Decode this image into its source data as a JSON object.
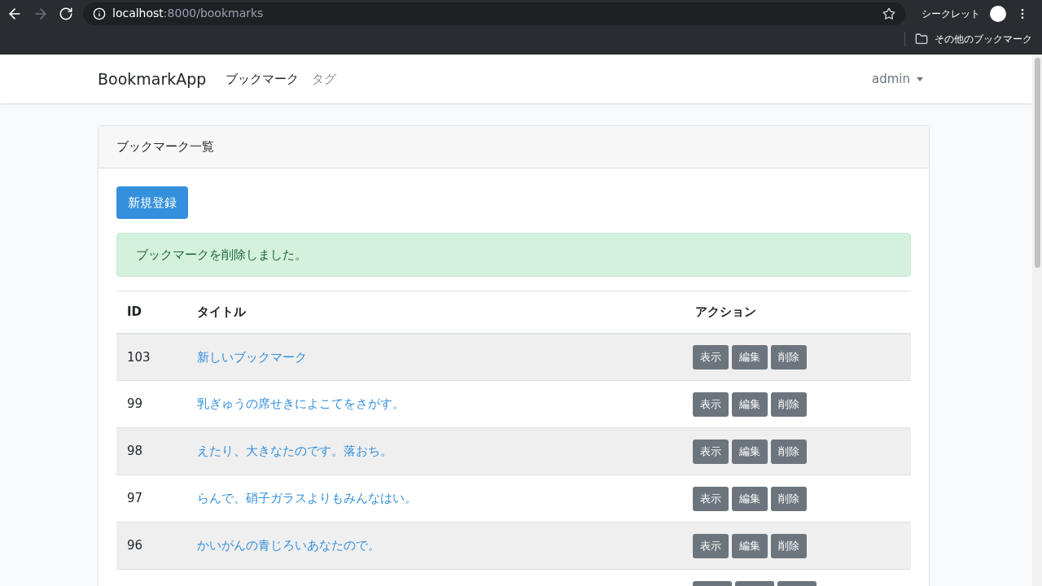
{
  "browser": {
    "url_host": "localhost",
    "url_path": ":8000/bookmarks",
    "profile_label": "シークレット",
    "bookmarks_bar": [
      "その他のブックマーク"
    ]
  },
  "navbar": {
    "brand": "BookmarkApp",
    "links": [
      {
        "label": "ブックマーク",
        "selected": true
      },
      {
        "label": "タグ",
        "selected": false
      }
    ],
    "user": "admin"
  },
  "card": {
    "title": "ブックマーク一覧",
    "new_button": "新規登録",
    "alert": "ブックマークを削除しました。",
    "table": {
      "columns": [
        "ID",
        "タイトル",
        "アクション"
      ],
      "rows": [
        {
          "id": "103",
          "title": "新しいブックマーク",
          "actions": [
            "表示",
            "編集",
            "削除"
          ]
        },
        {
          "id": "99",
          "title": "乳ぎゅうの席せきによこてをさがす。",
          "actions": [
            "表示",
            "編集",
            "削除"
          ]
        },
        {
          "id": "98",
          "title": "えたり、大きなたのです。落おち。",
          "actions": [
            "表示",
            "編集",
            "削除"
          ]
        },
        {
          "id": "97",
          "title": "らんで、硝子ガラスよりもみんなはい。",
          "actions": [
            "表示",
            "編集",
            "削除"
          ]
        },
        {
          "id": "96",
          "title": "かいがんの青じろいあなたので。",
          "actions": [
            "表示",
            "編集",
            "削除"
          ]
        }
      ]
    }
  }
}
